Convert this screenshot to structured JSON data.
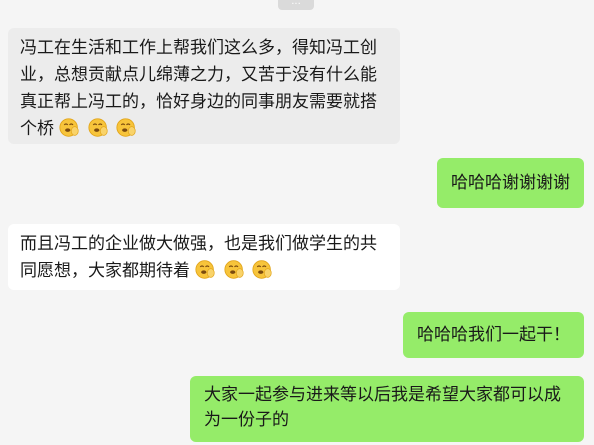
{
  "header": {
    "chip_text": "..."
  },
  "messages": [
    {
      "direction": "in",
      "text": "冯工在生活和工作上帮我们这么多，得知冯工创业，总想贡献点儿绵薄之力，又苦于没有什么能真正帮上冯工的，恰好身边的同事朋友需要就搭个桥",
      "emojis": [
        "clap-face",
        "clap-face",
        "clap-face"
      ]
    },
    {
      "direction": "out",
      "text": "哈哈哈谢谢谢谢"
    },
    {
      "direction": "in",
      "text": "而且冯工的企业做大做强，也是我们做学生的共同愿想，大家都期待着",
      "emojis": [
        "clap-face",
        "clap-face",
        "clap-face"
      ]
    },
    {
      "direction": "out",
      "text": "哈哈哈我们一起干！"
    },
    {
      "direction": "out",
      "text": "大家一起参与进来等以后我是希望大家都可以成为一份子的"
    }
  ],
  "colors": {
    "background": "#f5f5f5",
    "incoming_bubble": "#ececec",
    "incoming_bubble_white": "#ffffff",
    "outgoing_bubble": "#95ec69",
    "text": "#191919"
  }
}
